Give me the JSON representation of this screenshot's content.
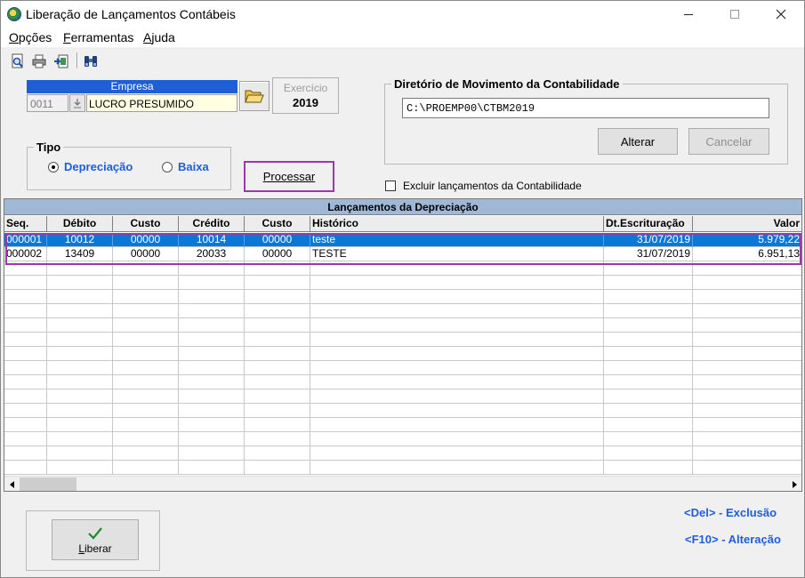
{
  "window": {
    "title": "Liberação de Lançamentos Contábeis"
  },
  "menu": {
    "opcoes_first": "O",
    "opcoes_rest": "pções",
    "ferramentas_first": "F",
    "ferramentas_rest": "erramentas",
    "ajuda_first": "A",
    "ajuda_rest": "juda"
  },
  "toolbar": {
    "icons": [
      "preview-icon",
      "print-icon",
      "export-icon",
      "binoculars-icon"
    ]
  },
  "empresa": {
    "label": "Empresa",
    "code": "0011",
    "name": "LUCRO PRESUMIDO"
  },
  "exercicio": {
    "label": "Exercício",
    "value": "2019"
  },
  "diretorio": {
    "title": "Diretório de Movimento da Contabilidade",
    "path": "C:\\PROEMP00\\CTBM2019",
    "alterar": "Alterar",
    "cancelar": "Cancelar"
  },
  "tipo": {
    "title": "Tipo",
    "options": [
      {
        "label": "Depreciação",
        "selected": true
      },
      {
        "label": "Baixa",
        "selected": false
      }
    ]
  },
  "processar": "Processar",
  "excluir_label": "Excluir lançamentos da Contabilidade",
  "grid": {
    "title": "Lançamentos da Depreciação",
    "columns": [
      "Seq.",
      "Débito",
      "Custo",
      "Crédito",
      "Custo",
      "Histórico",
      "Dt.Escrituração",
      "Valor"
    ],
    "rows": [
      [
        "000001",
        "10012",
        "00000",
        "10014",
        "00000",
        "teste",
        "31/07/2019",
        "5.979,22"
      ],
      [
        "000002",
        "13409",
        "00000",
        "20033",
        "00000",
        "TESTE",
        "31/07/2019",
        "6.951,13"
      ]
    ]
  },
  "liberar": {
    "first": "L",
    "rest": "iberar"
  },
  "hints": {
    "del": "<Del> - Exclusão",
    "f10": "<F10> - Alteração"
  },
  "colors": {
    "accent_blue": "#1f5fd6",
    "selection": "#0a78d7",
    "highlight": "#9a3aa6",
    "grid_title": "#9fb8d6"
  }
}
